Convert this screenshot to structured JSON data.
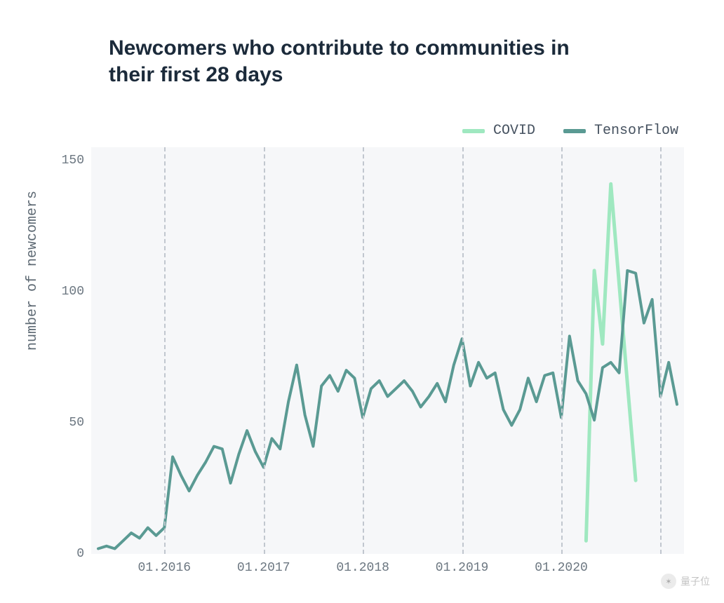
{
  "title": "Newcomers who contribute to communities in their first 28 days",
  "ylabel": "number of newcomers",
  "legend": {
    "covid": "COVID",
    "tensorflow": "TensorFlow"
  },
  "colors": {
    "covid": "#9fe8c0",
    "tensorflow": "#5a9a93",
    "plot_bg": "#f6f7f9",
    "grid": "#c1c7cf",
    "text": "#1b2a3a"
  },
  "y_ticks": [
    0,
    50,
    100,
    150
  ],
  "x_ticks": [
    "01.2016",
    "01.2017",
    "01.2018",
    "01.2019",
    "01.2020"
  ],
  "watermark": "量子位",
  "chart_data": {
    "type": "line",
    "xlabel": "",
    "ylabel": "number of newcomers",
    "title": "Newcomers who contribute to communities in their first 28 days",
    "ylim": [
      0,
      155
    ],
    "x_start": "2015-05",
    "x_end": "2020-09",
    "x_step_months": 1,
    "series": [
      {
        "name": "TensorFlow",
        "color": "#5a9a93",
        "values": [
          2,
          3,
          2,
          5,
          8,
          6,
          10,
          7,
          10,
          37,
          30,
          24,
          30,
          35,
          41,
          40,
          27,
          38,
          47,
          39,
          33,
          44,
          40,
          58,
          72,
          53,
          41,
          64,
          68,
          62,
          70,
          67,
          52,
          63,
          66,
          60,
          63,
          66,
          62,
          56,
          60,
          65,
          58,
          72,
          82,
          64,
          73,
          67,
          69,
          55,
          49,
          55,
          67,
          58,
          68,
          69,
          52,
          83,
          66,
          61,
          51,
          71,
          73,
          69,
          108,
          107,
          88,
          97,
          60,
          73,
          57
        ]
      },
      {
        "name": "COVID",
        "color": "#9fe8c0",
        "start_index": 59,
        "values": [
          5,
          108,
          80,
          141,
          103,
          65,
          28
        ]
      }
    ]
  }
}
